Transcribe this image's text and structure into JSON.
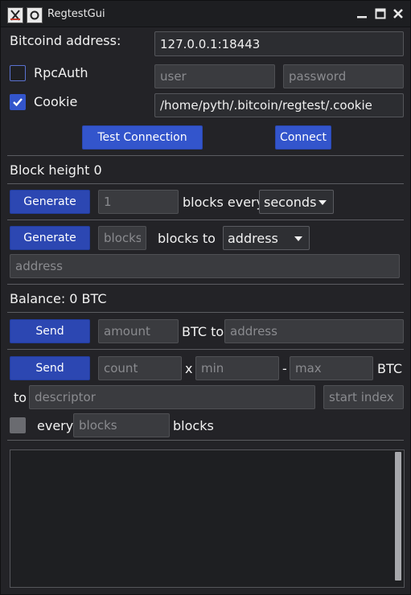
{
  "window": {
    "title": "RegtestGui"
  },
  "connection": {
    "address_label": "Bitcoind address:",
    "address_value": "127.0.0.1:18443",
    "rpcauth_label": "RpcAuth",
    "rpcauth_checked": false,
    "user_placeholder": "user",
    "password_placeholder": "password",
    "cookie_label": "Cookie",
    "cookie_checked": true,
    "cookie_path": "/home/pyth/.bitcoin/regtest/.cookie",
    "test_button": "Test Connection",
    "connect_button": "Connect"
  },
  "block": {
    "height_text": "Block height 0",
    "generate_label": "Generate",
    "count_value": "1",
    "every_text": "blocks every",
    "unit_selected": "seconds",
    "generate2_label": "Generate",
    "blocks_placeholder": "blocks",
    "blocks_to_text": "blocks to",
    "target_selected": "address",
    "address_placeholder": "address"
  },
  "wallet": {
    "balance_text": "Balance: 0 BTC",
    "send_label": "Send",
    "amount_placeholder": "amount",
    "btc_to_text": "BTC to",
    "address_placeholder": "address",
    "send2_label": "Send",
    "count_placeholder": "count",
    "x_text": "x",
    "min_placeholder": "min",
    "dash_text": "-",
    "max_placeholder": "max",
    "btc_text": "BTC",
    "to_text": "to",
    "descriptor_placeholder": "descriptor",
    "start_index_placeholder": "start index",
    "every_text": "every",
    "every_checked": false,
    "blocks_placeholder": "blocks",
    "blocks_text": "blocks"
  },
  "colors": {
    "accent": "#3355cc",
    "window_bg": "#232327",
    "desktop_bg": "#7a3a55"
  }
}
